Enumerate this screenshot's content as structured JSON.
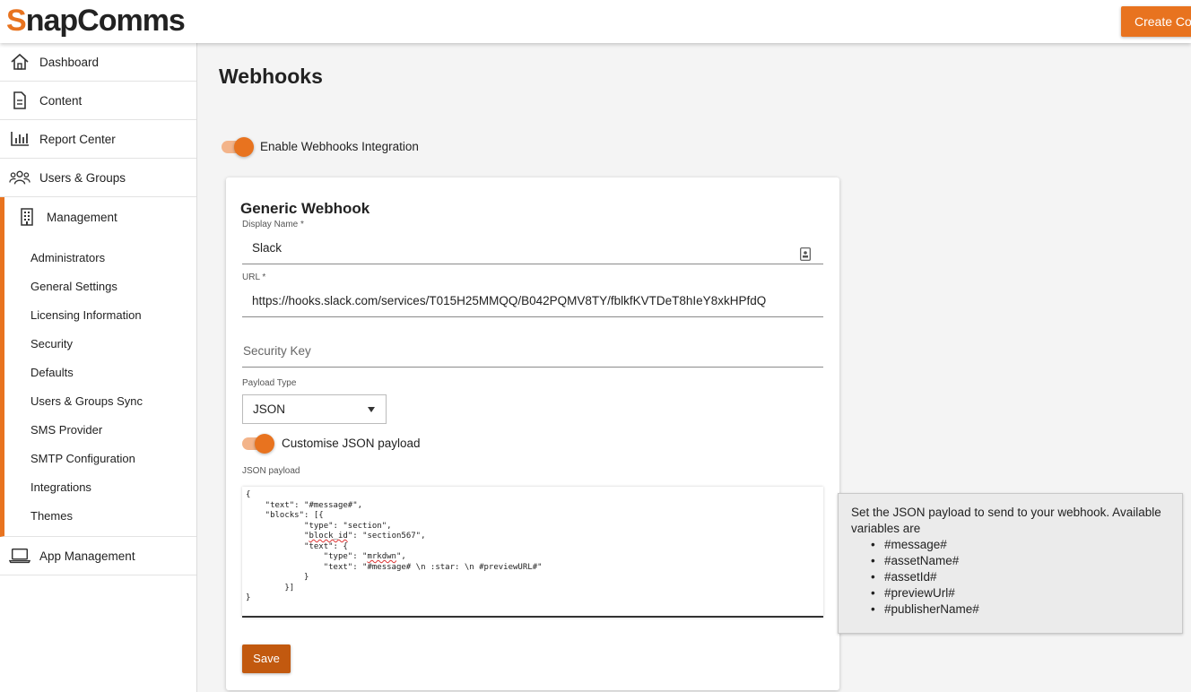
{
  "header": {
    "logo_first_letter": "S",
    "logo_rest": "napComms",
    "create_button_label": "Create Co"
  },
  "sidebar": {
    "items": [
      {
        "label": "Dashboard",
        "icon": "home-icon"
      },
      {
        "label": "Content",
        "icon": "document-icon"
      },
      {
        "label": "Report Center",
        "icon": "bar-chart-icon"
      },
      {
        "label": "Users & Groups",
        "icon": "users-icon"
      }
    ],
    "management": {
      "label": "Management",
      "icon": "building-icon"
    },
    "sub_items": [
      "Administrators",
      "General Settings",
      "Licensing Information",
      "Security",
      "Defaults",
      "Users & Groups Sync",
      "SMS Provider",
      "SMTP Configuration",
      "Integrations",
      "Themes"
    ],
    "app_management": {
      "label": "App Management",
      "icon": "laptop-icon"
    }
  },
  "page": {
    "title": "Webhooks",
    "enable_toggle_label": "Enable Webhooks Integration",
    "enable_toggle_on": true
  },
  "webhook_card": {
    "title": "Generic Webhook",
    "display_name_label": "Display Name *",
    "display_name_value": "Slack",
    "url_label": "URL *",
    "url_value": "https://hooks.slack.com/services/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",
    "security_key_placeholder": "Security Key",
    "payload_type_label": "Payload Type",
    "payload_type_value": "JSON",
    "customise_toggle_label": "Customise JSON payload",
    "customise_toggle_on": true,
    "json_payload_label": "JSON payload",
    "json_lines": {
      "l1": "{",
      "l2": "    \"text\": \"#message#\",",
      "l3": "    \"blocks\": [{",
      "l4": "            \"type\": \"section\",",
      "l5_pre": "            \"",
      "l5_squiggle": "block_id",
      "l5_post": "\": \"section567\",",
      "l6": "            \"text\": {",
      "l7_pre": "                \"type\": \"",
      "l7_squiggle": "mrkdwn",
      "l7_post": "\",",
      "l8": "                \"text\": \"#message# \\n :star: \\n #previewURL#\"",
      "l9": "            }",
      "l10": "        }]",
      "l11": "}"
    },
    "save_label": "Save"
  },
  "help_panel": {
    "intro": "Set the JSON payload to send to your webhook. Available variables are",
    "variables": [
      "#message#",
      "#assetName#",
      "#assetId#",
      "#previewUrl#",
      "#publisherName#"
    ]
  },
  "colors": {
    "accent": "#e8731f",
    "accent_light": "#f3b48a",
    "save_button": "#c2590f"
  }
}
